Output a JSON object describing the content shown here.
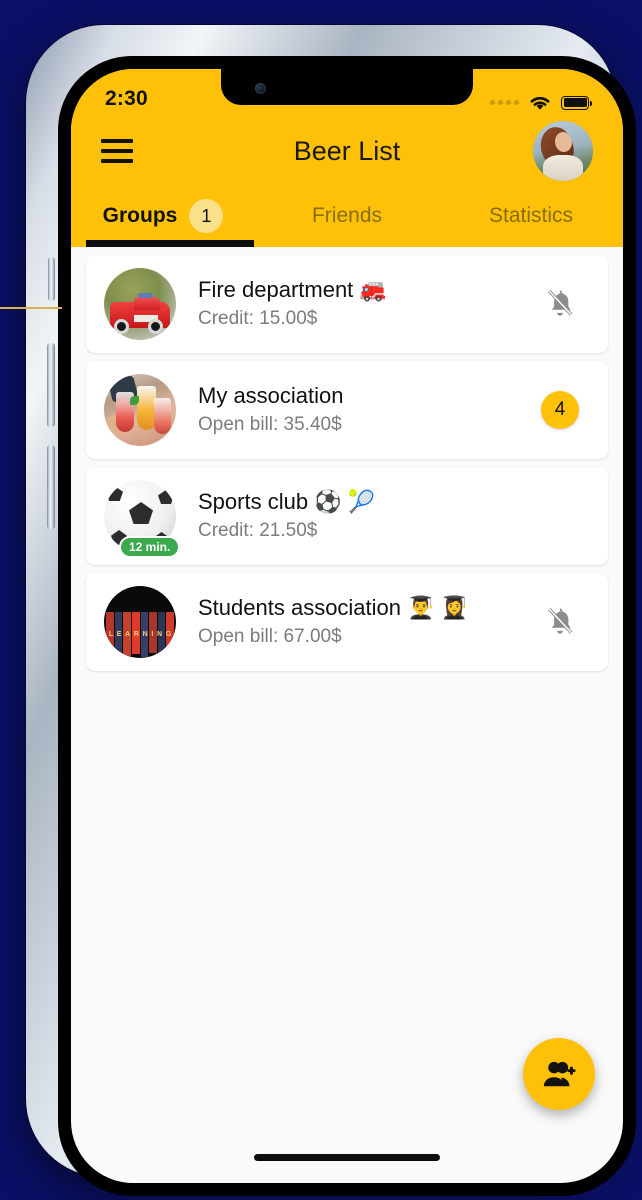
{
  "status_bar": {
    "time": "2:30",
    "signal_icon": "signal-dots-icon",
    "wifi_icon": "wifi-icon",
    "battery_icon": "battery-full-icon"
  },
  "app_bar": {
    "menu_icon": "hamburger-menu-icon",
    "title": "Beer List",
    "avatar_icon": "user-profile-avatar"
  },
  "tabs": [
    {
      "label": "Groups",
      "badge": "1",
      "active": true
    },
    {
      "label": "Friends",
      "badge": null,
      "active": false
    },
    {
      "label": "Statistics",
      "badge": null,
      "active": false
    }
  ],
  "groups": [
    {
      "name": "Fire department 🚒",
      "subtitle": "Credit: 15.00$",
      "avatar": "fire-truck-photo",
      "trailing_type": "bell-off-icon",
      "trailing_value": null,
      "time_badge": null
    },
    {
      "name": "My association",
      "subtitle": "Open bill: 35.40$",
      "avatar": "cocktail-cheers-photo",
      "trailing_type": "count-badge",
      "trailing_value": "4",
      "time_badge": null
    },
    {
      "name": "Sports club ⚽ 🎾",
      "subtitle": "Credit: 21.50$",
      "avatar": "soccer-ball-photo",
      "trailing_type": "none",
      "trailing_value": null,
      "time_badge": "12 min."
    },
    {
      "name": "Students association 👨‍🎓 👩‍🎓",
      "subtitle": "Open bill: 67.00$",
      "avatar": "books-shelf-photo",
      "trailing_type": "bell-off-icon",
      "trailing_value": null,
      "time_badge": null
    }
  ],
  "fab": {
    "icon": "person-add-icon"
  },
  "colors": {
    "brand_yellow": "#FFC107",
    "badge_light_yellow": "#FAE08A",
    "time_badge_green": "#3CA94C",
    "page_background": "#0A1065",
    "muted_text": "#7C7C7C"
  }
}
